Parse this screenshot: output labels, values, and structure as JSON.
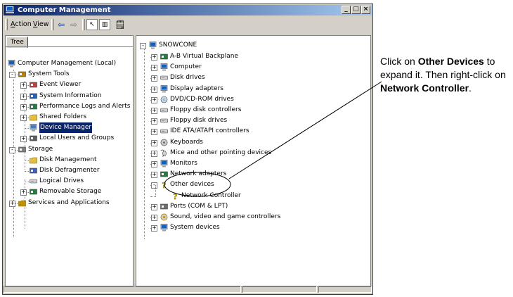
{
  "window": {
    "title": "Computer Management",
    "menu": [
      {
        "label": "Action",
        "mnemonic": "A"
      },
      {
        "label": "View",
        "mnemonic": "V"
      }
    ]
  },
  "left_pane": {
    "tab": "Tree",
    "items": [
      {
        "label": "Computer Management (Local)",
        "icon": "computer-management-icon"
      },
      {
        "label": "System Tools",
        "icon": "tools-icon"
      },
      {
        "label": "Event Viewer",
        "icon": "event-viewer-icon"
      },
      {
        "label": "System Information",
        "icon": "system-info-icon"
      },
      {
        "label": "Performance Logs and Alerts",
        "icon": "performance-icon"
      },
      {
        "label": "Shared Folders",
        "icon": "shared-folder-icon"
      },
      {
        "label": "Device Manager",
        "icon": "device-manager-icon",
        "selected": true
      },
      {
        "label": "Local Users and Groups",
        "icon": "users-icon"
      },
      {
        "label": "Storage",
        "icon": "storage-icon"
      },
      {
        "label": "Disk Management",
        "icon": "disk-management-icon"
      },
      {
        "label": "Disk Defragmenter",
        "icon": "defragmenter-icon"
      },
      {
        "label": "Logical Drives",
        "icon": "logical-drives-icon"
      },
      {
        "label": "Removable Storage",
        "icon": "removable-storage-icon"
      },
      {
        "label": "Services and Applications",
        "icon": "services-icon"
      }
    ]
  },
  "right_pane": {
    "root": "SNOWCONE",
    "items": [
      {
        "label": "A-B Virtual Backplane",
        "icon": "backplane-icon"
      },
      {
        "label": "Computer",
        "icon": "computer-icon"
      },
      {
        "label": "Disk drives",
        "icon": "disk-drive-icon"
      },
      {
        "label": "Display adapters",
        "icon": "display-adapter-icon"
      },
      {
        "label": "DVD/CD-ROM drives",
        "icon": "cdrom-icon"
      },
      {
        "label": "Floppy disk controllers",
        "icon": "floppy-controller-icon"
      },
      {
        "label": "Floppy disk drives",
        "icon": "floppy-drive-icon"
      },
      {
        "label": "IDE ATA/ATAPI controllers",
        "icon": "ide-controller-icon"
      },
      {
        "label": "Keyboards",
        "icon": "keyboard-icon"
      },
      {
        "label": "Mice and other pointing devices",
        "icon": "mouse-icon"
      },
      {
        "label": "Monitors",
        "icon": "monitor-icon"
      },
      {
        "label": "Network adapters",
        "icon": "network-adapter-icon"
      },
      {
        "label": "Other devices",
        "icon": "question-mark-icon"
      },
      {
        "label": "Network Controller",
        "icon": "warning-question-icon"
      },
      {
        "label": "Ports (COM & LPT)",
        "icon": "port-icon"
      },
      {
        "label": "Sound, video and game controllers",
        "icon": "sound-icon"
      },
      {
        "label": "System devices",
        "icon": "system-devices-icon"
      }
    ]
  },
  "callout": {
    "t1": "Click on ",
    "b1": "Other Devices",
    "t2": " to expand it. Then right-click on ",
    "b2": "Network Controller",
    "t3": "."
  }
}
